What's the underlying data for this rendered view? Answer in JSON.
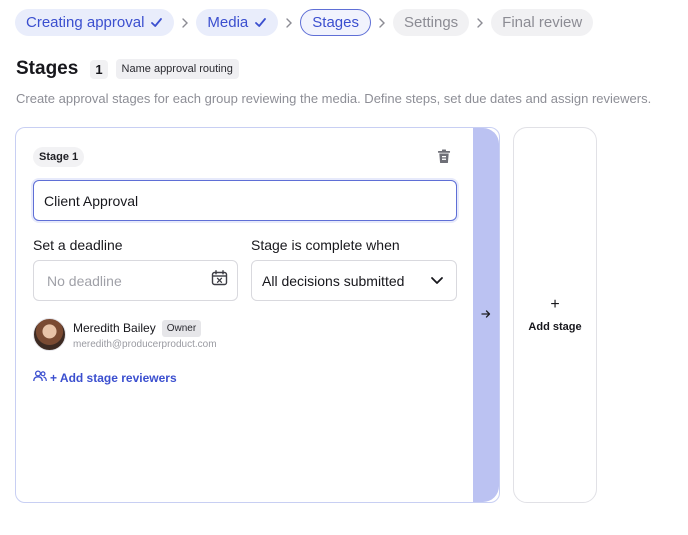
{
  "breadcrumb": {
    "steps": [
      {
        "label": "Creating approval",
        "state": "done"
      },
      {
        "label": "Media",
        "state": "done"
      },
      {
        "label": "Stages",
        "state": "current"
      },
      {
        "label": "Settings",
        "state": "todo"
      },
      {
        "label": "Final review",
        "state": "todo"
      }
    ]
  },
  "header": {
    "title": "Stages",
    "count": "1",
    "tag": "Name approval routing",
    "subtitle": "Create approval stages for each group reviewing the media. Define steps, set due dates and assign reviewers."
  },
  "stage": {
    "label": "Stage 1",
    "name_value": "Client Approval",
    "deadline_label": "Set a deadline",
    "deadline_placeholder": "No deadline",
    "complete_label": "Stage is complete when",
    "complete_value": "All decisions submitted",
    "reviewer": {
      "name": "Meredith Bailey",
      "role": "Owner",
      "email": "meredith@producerproduct.com"
    },
    "add_reviewers_label": "+ Add stage reviewers"
  },
  "add_stage": {
    "plus": "+",
    "label": "Add stage"
  },
  "colors": {
    "accent": "#3b4fcf",
    "rail": "#bbc2f2"
  },
  "icons": [
    "check-icon",
    "chevron-right-icon",
    "trash-icon",
    "calendar-icon",
    "chevron-down-icon",
    "arrow-right-icon",
    "users-icon"
  ]
}
